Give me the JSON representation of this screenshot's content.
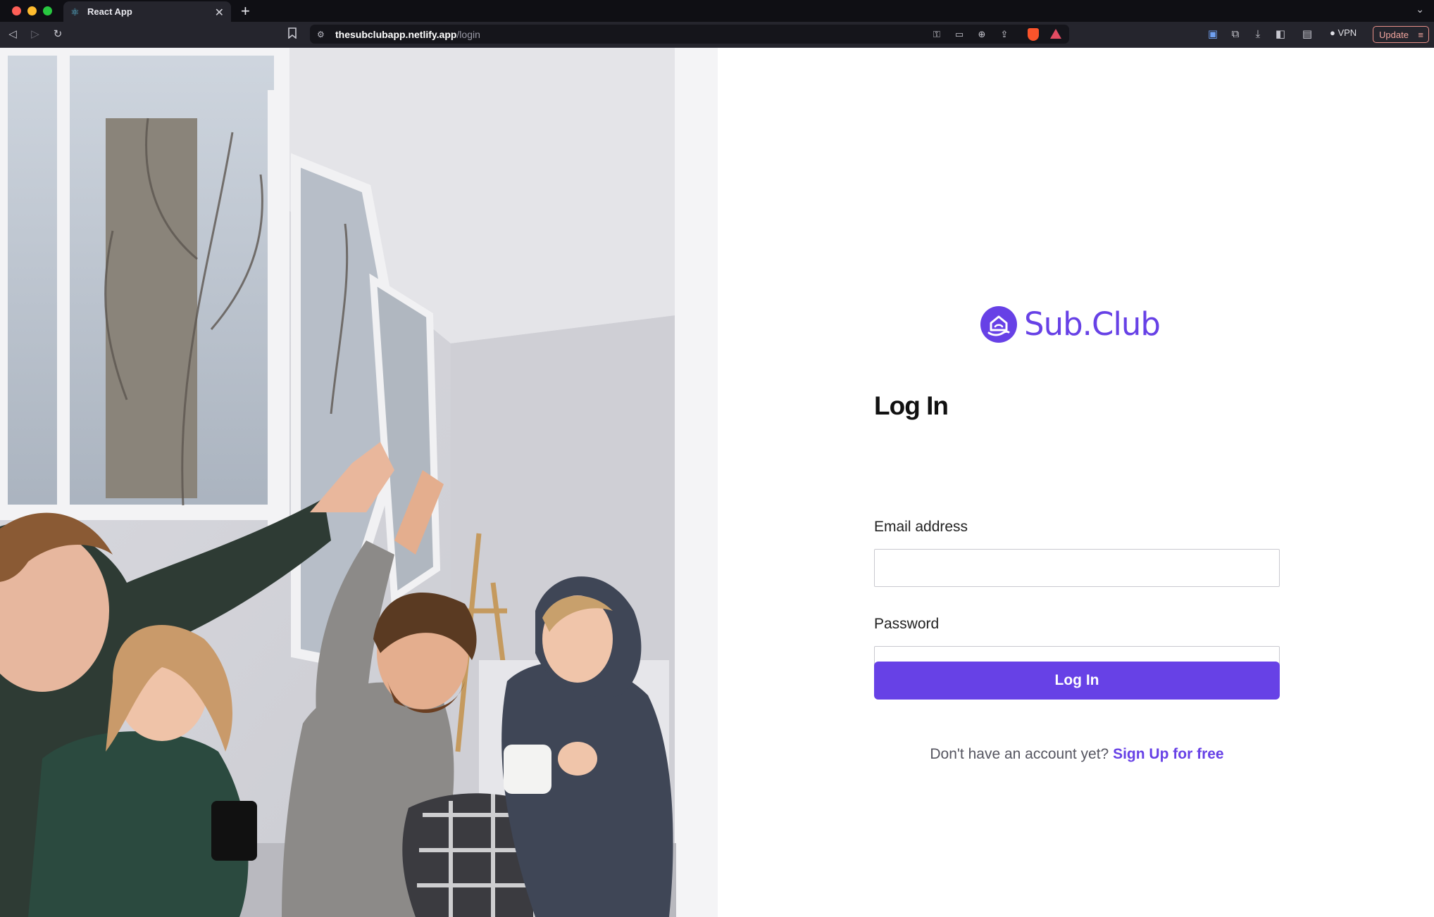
{
  "browser": {
    "tab_title": "React App",
    "url_host": "thesubclubapp.netlify.app",
    "url_path": "/login",
    "vpn_label": "VPN",
    "update_label": "Update",
    "icons": {
      "tab_favicon": "react-icon",
      "back": "back-icon",
      "forward": "forward-icon",
      "reload": "reload-icon",
      "bookmark": "bookmark-icon",
      "site_info": "site-settings-icon",
      "key": "key-icon",
      "cast": "cast-icon",
      "zoom": "zoom-icon",
      "share": "share-icon",
      "brave_shield": "brave-shield-icon",
      "brave_rewards": "brave-rewards-icon",
      "translate": "translate-icon",
      "extensions": "extensions-icon",
      "downloads": "download-icon",
      "sidebar": "sidebar-icon",
      "wallet": "wallet-icon"
    }
  },
  "brand": {
    "name": "Sub.Club",
    "accent_color": "#6741e6"
  },
  "login": {
    "title": "Log In",
    "email_label": "Email address",
    "email_value": "",
    "password_label": "Password",
    "password_value": "",
    "submit_label": "Log In",
    "signup_prompt": "Don't have an account yet?",
    "signup_link": "Sign Up for free"
  }
}
